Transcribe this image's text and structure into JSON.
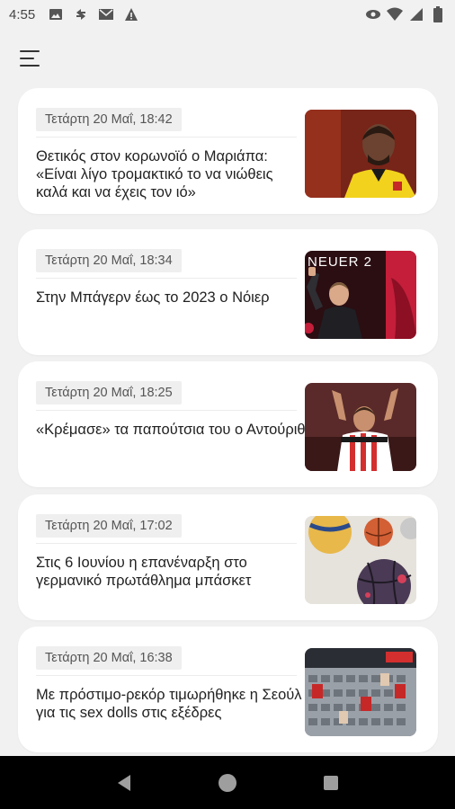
{
  "status": {
    "time": "4:55",
    "left_icons": [
      "image-icon",
      "sync-icon",
      "mail-icon",
      "warning-icon"
    ],
    "right_icons": [
      "eye-icon",
      "wifi-icon",
      "signal-icon",
      "battery-icon"
    ]
  },
  "appbar": {
    "menu_icon": "hamburger-menu-icon"
  },
  "articles": [
    {
      "date": "Τετάρτη 20 Μαΐ, 18:42",
      "title": "Θετικός στον κορωνοϊό ο Μαριάπα: «Είναι λίγο τρομακτικό το να νιώθεις καλά και να έχεις τον ιό»",
      "thumb": "footballer-yellow-jersey"
    },
    {
      "date": "Τετάρτη 20 Μαΐ, 18:34",
      "title": "Στην Μπάγερν έως το 2023 ο Νόιερ",
      "thumb": "goalkeeper-neuer",
      "thumb_text": "NEUER 2"
    },
    {
      "date": "Τετάρτη 20 Μαΐ, 18:25",
      "title": "«Κρέμασε» τα παπούτσια του ο Αντούριθ",
      "thumb": "player-celebrating"
    },
    {
      "date": "Τετάρτη 20 Μαΐ, 17:02",
      "title": "Στις 6 Ιουνίου η επανέναρξη στο γερμανικό πρωτάθλημα μπάσκετ",
      "thumb": "basketballs"
    },
    {
      "date": "Τετάρτη 20 Μαΐ, 16:38",
      "title": "Με πρόστιμο-ρεκόρ τιμωρήθηκε η Σεούλ για τις sex dolls στις εξέδρες",
      "thumb": "stadium-stands"
    }
  ],
  "navbar": {
    "back": "back-icon",
    "home": "home-icon",
    "recents": "recents-icon"
  },
  "colors": {
    "background": "#f1f1f1",
    "card": "#ffffff",
    "chip": "#efefef",
    "navbar": "#000000"
  }
}
